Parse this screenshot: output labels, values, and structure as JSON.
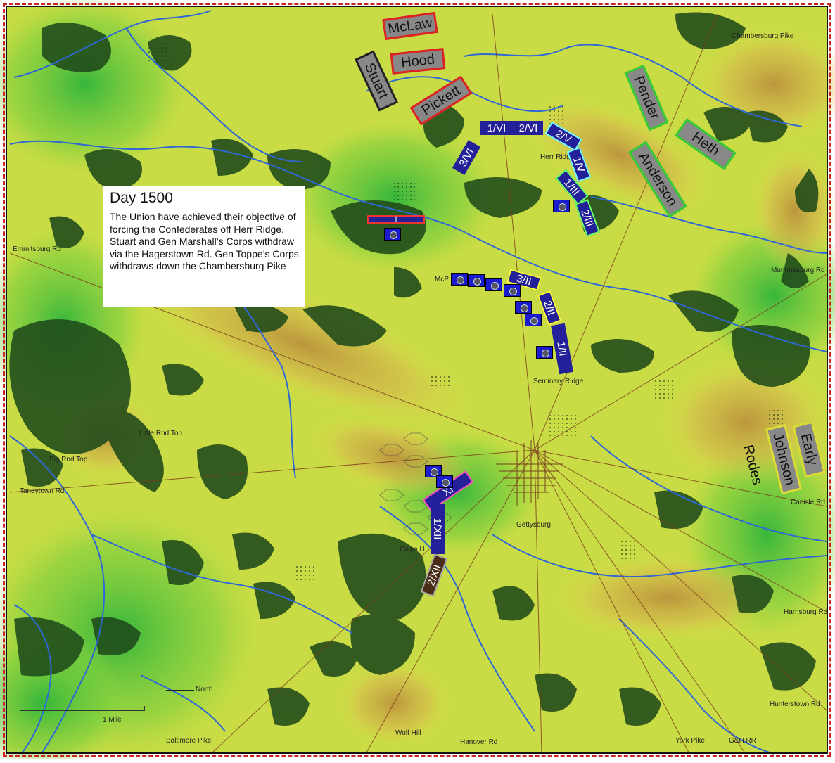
{
  "info": {
    "title": "Day 1500",
    "text": "The Union have achieved their objective of forcing the Confederates off Herr Ridge.  Stuart and Gen Marshall’s Corps withdraw via the Hagerstown Rd.  Gen Toppe’s Corps withdraws down the Chambersburg Pike"
  },
  "places": {
    "chambersburg_pike": "Chambersburg Pike",
    "emmitsburg_rd": "Emmitsburg Rd",
    "mummasburg_rd": "Mummasburg Rd",
    "herr_ridge": "Herr Ridg",
    "mcp": "McP",
    "seminary_ridge": "Seminary Ridge",
    "little_rnd_top": "Little Rnd Top",
    "big_rnd_top": "Big Rnd Top",
    "taneytown_rd": "Taneytown Rd",
    "gettysburg": "Gettysburg",
    "culps": "Culps H",
    "carlisle_rd": "Carlisle Rd",
    "harrisburg_rd": "Harrisburg Rd",
    "hunterstown_rd": "Hunterstown Rd",
    "york_pike": "York Pike",
    "gh_rr": "G&H RR",
    "baltimore_pike": "Baltimore Pike",
    "wolf_hill": "Wolf Hill",
    "hanover_rd": "Hanover Rd",
    "north": "North",
    "one_mile": "1 Mile"
  },
  "confederate_units": [
    {
      "label": "McLaw",
      "border": "red"
    },
    {
      "label": "Hood",
      "border": "red"
    },
    {
      "label": "Stuart",
      "border": "black"
    },
    {
      "label": "Pickett",
      "border": "red"
    },
    {
      "label": "Pender",
      "border": "green"
    },
    {
      "label": "Heth",
      "border": "green"
    },
    {
      "label": "Anderson",
      "border": "green"
    },
    {
      "label": "Early",
      "border": "yellow"
    },
    {
      "label": "Johnson",
      "border": "yellow"
    },
    {
      "label": "Rodes",
      "border": "yellow"
    }
  ],
  "union_units": [
    {
      "label": "1/VI"
    },
    {
      "label": "2/VI"
    },
    {
      "label": "3/VI"
    },
    {
      "label": "2/V"
    },
    {
      "label": "1/V"
    },
    {
      "label": "1/III"
    },
    {
      "label": "2/III"
    },
    {
      "label": "3/II"
    },
    {
      "label": "2/II"
    },
    {
      "label": "1/II"
    },
    {
      "label": "I"
    },
    {
      "label": "XI"
    },
    {
      "label": "1/XII"
    },
    {
      "label": "2/XII"
    }
  ],
  "colors": {
    "land_low": "#2fbf3a",
    "land_mid": "#9fd83c",
    "land_high": "#e6d750",
    "ridge": "#b98a3c",
    "forest": "#1f4a1a",
    "river": "#2f67d6",
    "union": "#24209a",
    "confederate": "#888888"
  }
}
